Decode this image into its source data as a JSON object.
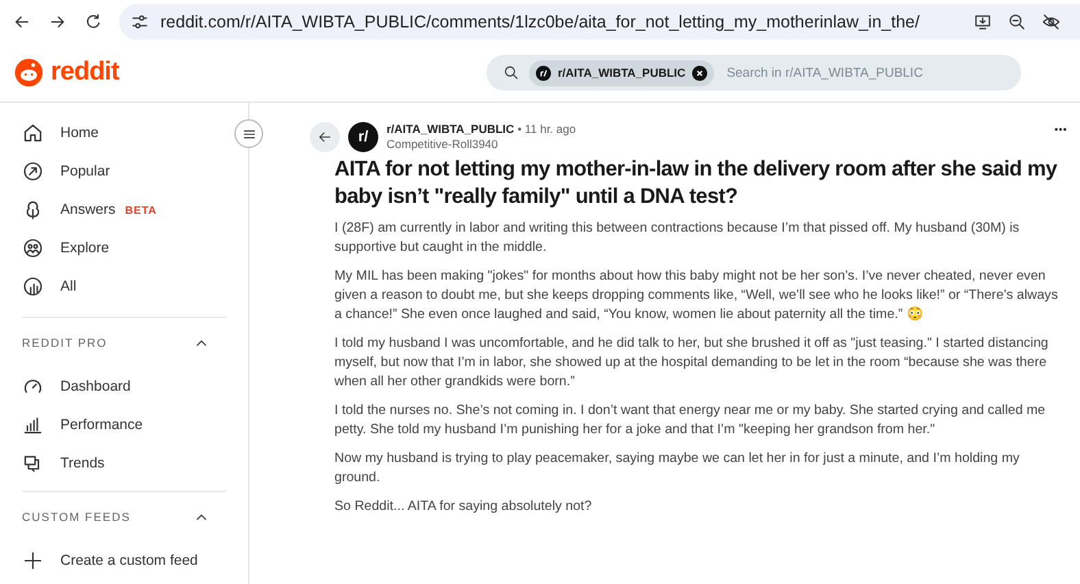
{
  "browser": {
    "url": "reddit.com/r/AITA_WIBTA_PUBLIC/comments/1lzc0be/aita_for_not_letting_my_motherinlaw_in_the/"
  },
  "header": {
    "logo": "reddit",
    "search": {
      "chip": "r/AITA_WIBTA_PUBLIC",
      "placeholder": "Search in r/AITA_WIBTA_PUBLIC"
    }
  },
  "sidebar": {
    "items": [
      {
        "label": "Home"
      },
      {
        "label": "Popular"
      },
      {
        "label": "Answers",
        "badge": "BETA"
      },
      {
        "label": "Explore"
      },
      {
        "label": "All"
      }
    ],
    "sections": [
      {
        "title": "REDDIT PRO",
        "expanded": true,
        "items": [
          {
            "label": "Dashboard"
          },
          {
            "label": "Performance"
          },
          {
            "label": "Trends"
          }
        ]
      },
      {
        "title": "CUSTOM FEEDS",
        "expanded": true,
        "items": [
          {
            "label": "Create a custom feed"
          }
        ]
      }
    ]
  },
  "post": {
    "avatar": "r/",
    "subreddit": "r/AITA_WIBTA_PUBLIC",
    "time": "• 11 hr. ago",
    "author": "Competitive-Roll3940",
    "more": "•••",
    "title": "AITA for not letting my mother-in-law in the delivery room after she said my baby isn’t \"really family\" until a DNA test?",
    "paragraphs": [
      "I (28F) am currently in labor and writing this between contractions because I’m that pissed off. My husband (30M) is supportive but caught in the middle.",
      "My MIL has been making \"jokes\" for months about how this baby might not be her son’s. I’ve never cheated, never even given a reason to doubt me, but she keeps dropping comments like, “Well, we’ll see who he looks like!” or “There’s always a chance!” She even once laughed and said, “You know, women lie about paternity all the time.” 😳",
      "I told my husband I was uncomfortable, and he did talk to her, but she brushed it off as \"just teasing.\" I started distancing myself, but now that I’m in labor, she showed up at the hospital demanding to be let in the room “because she was there when all her other grandkids were born.”",
      "I told the nurses no. She’s not coming in. I don’t want that energy near me or my baby. She started crying and called me petty. She told my husband I’m punishing her for a joke and that I’m \"keeping her grandson from her.\"",
      "Now my husband is trying to play peacemaker, saying maybe we can let her in for just a minute, and I’m holding my ground.",
      "So Reddit... AITA for saying absolutely not?"
    ]
  }
}
